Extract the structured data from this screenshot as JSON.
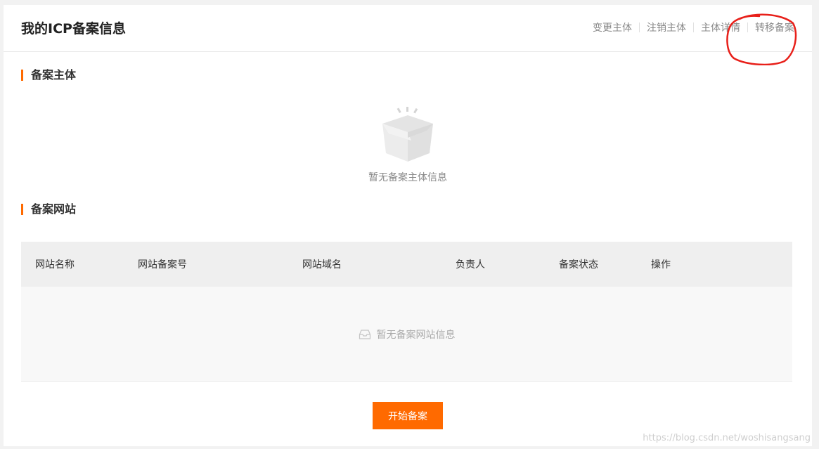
{
  "header": {
    "title": "我的ICP备案信息",
    "actions": [
      "变更主体",
      "注销主体",
      "主体详情",
      "转移备案"
    ]
  },
  "subject_section": {
    "title": "备案主体",
    "empty_text": "暂无备案主体信息"
  },
  "website_section": {
    "title": "备案网站",
    "columns": [
      "网站名称",
      "网站备案号",
      "网站域名",
      "负责人",
      "备案状态",
      "操作"
    ],
    "empty_text": "暂无备案网站信息"
  },
  "start_button": "开始备案",
  "watermark": "https://blog.csdn.net/woshisangsang",
  "colors": {
    "accent": "#ff6a00",
    "annotation": "#e8201a"
  }
}
